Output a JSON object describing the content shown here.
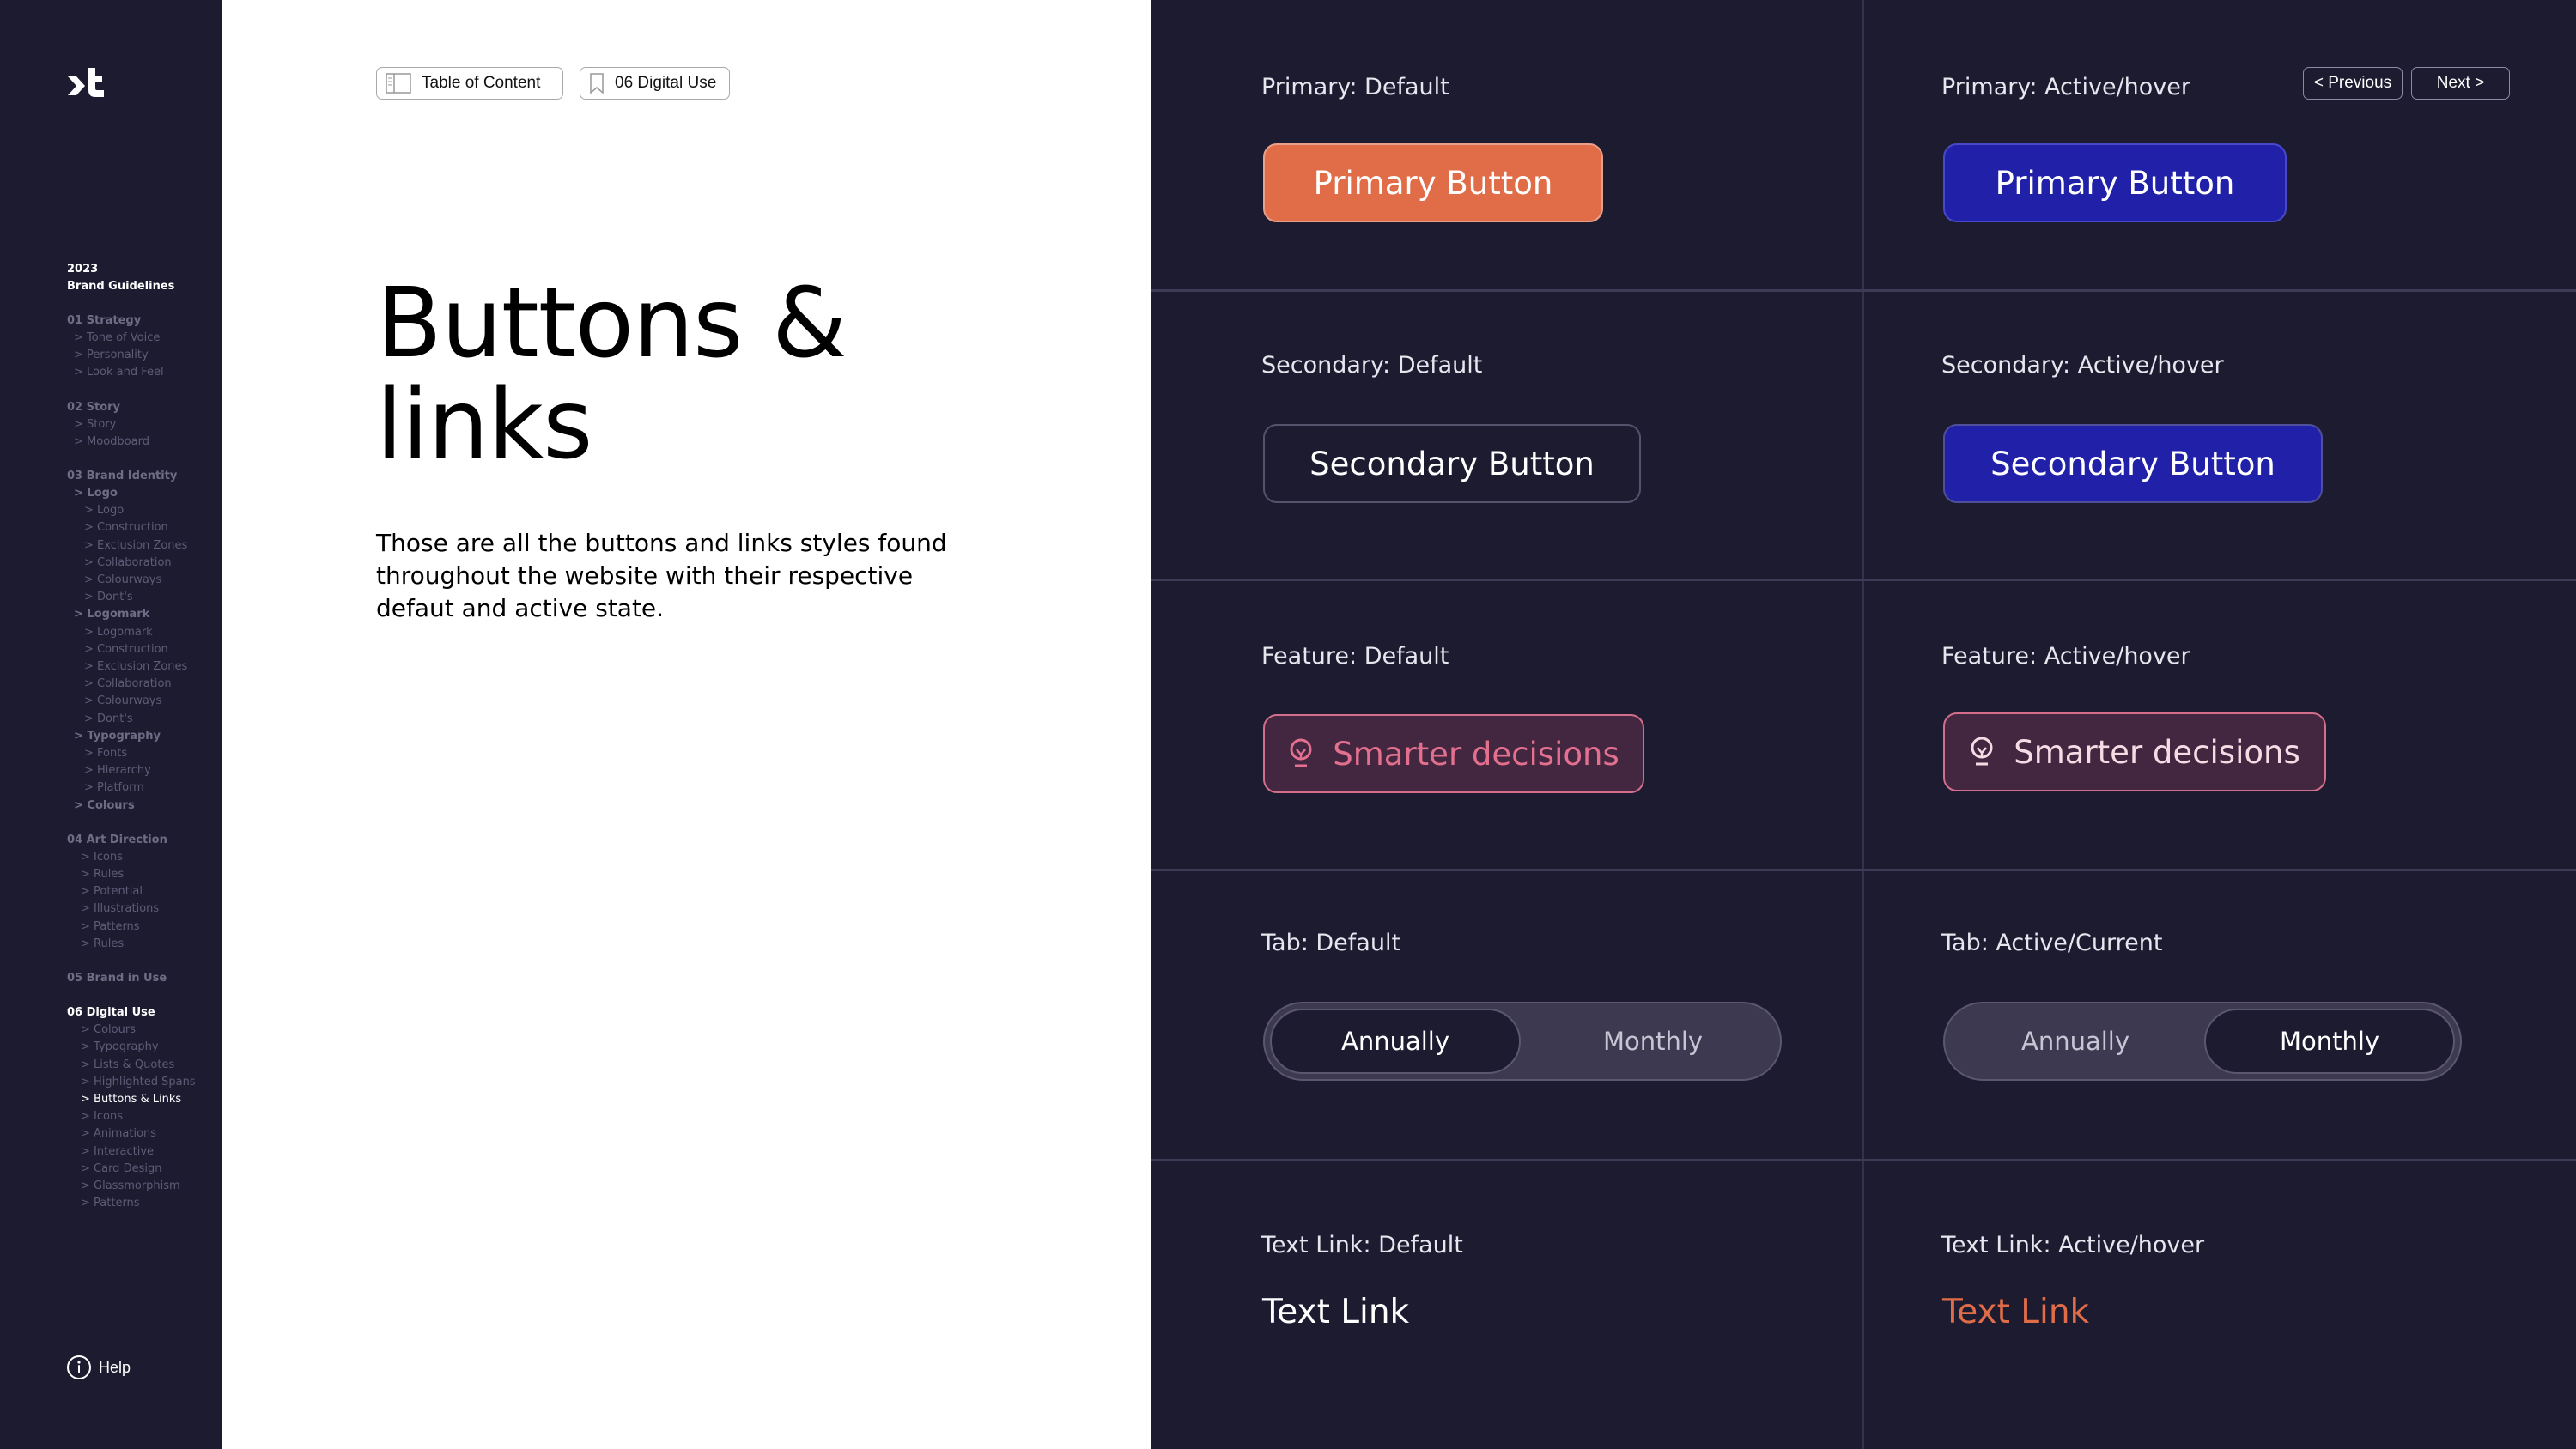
{
  "sidebar": {
    "logo": "xt",
    "year": "2023",
    "title": "Brand Guidelines",
    "groups": [
      {
        "head": "01 Strategy",
        "items": [
          "> Tone of Voice",
          "> Personality",
          "> Look and Feel"
        ]
      },
      {
        "head": "02 Story",
        "items": [
          "> Story",
          "> Moodboard"
        ]
      },
      {
        "head": "03 Brand Identity",
        "sections": [
          {
            "label": "> Logo",
            "items": [
              "> Logo",
              "> Construction",
              "> Exclusion Zones",
              "> Collaboration",
              "> Colourways",
              "> Dont's"
            ]
          },
          {
            "label": "> Logomark",
            "items": [
              "> Logomark",
              "> Construction",
              "> Exclusion Zones",
              "> Collaboration",
              "> Colourways",
              "> Dont's"
            ]
          },
          {
            "label": "> Typography",
            "items": [
              "> Fonts",
              "> Hierarchy",
              "> Platform"
            ]
          },
          {
            "label": "> Colours",
            "items": []
          }
        ]
      },
      {
        "head": "04 Art Direction",
        "items": [
          "> Icons",
          "> Rules",
          "> Potential",
          "> Illustrations",
          "> Patterns",
          "> Rules"
        ]
      },
      {
        "head": "05 Brand in Use",
        "items": []
      },
      {
        "head": "06 Digital Use",
        "items": [
          "> Colours",
          "> Typography",
          "> Lists & Quotes",
          "> Highlighted Spans",
          "> Buttons & Links",
          "> Icons",
          "> Animations",
          "> Interactive",
          "> Card Design",
          "> Glassmorphism",
          "> Patterns"
        ],
        "current": "> Buttons & Links"
      }
    ],
    "help": "Help"
  },
  "breadcrumb": {
    "toc": "Table of Content",
    "section": "06 Digital Use"
  },
  "page": {
    "title_line1": "Buttons &",
    "title_line2": "links",
    "description": "Those are all the buttons and links styles found throughout the website with their respective defaut and active state."
  },
  "pager": {
    "previous": "< Previous",
    "next": "Next >"
  },
  "showcase": {
    "primary": {
      "default_label": "Primary: Default",
      "active_label": "Primary: Active/hover",
      "button": "Primary Button"
    },
    "secondary": {
      "default_label": "Secondary: Default",
      "active_label": "Secondary: Active/hover",
      "button": "Secondary Button"
    },
    "feature": {
      "default_label": "Feature: Default",
      "active_label": "Feature: Active/hover",
      "button": "Smarter decisions",
      "icon": "lightbulb-icon"
    },
    "tab": {
      "default_label": "Tab: Default",
      "active_label": "Tab: Active/Current",
      "options": [
        "Annually",
        "Monthly"
      ],
      "default_selected": "Annually",
      "active_selected": "Monthly"
    },
    "textlink": {
      "default_label": "Text Link: Default",
      "active_label": "Text Link: Active/hover",
      "link": "Text Link"
    }
  },
  "colors": {
    "sidebar_bg": "#1d1b30",
    "primary_orange": "#e06d48",
    "active_blue": "#2020a8",
    "feature_bg": "#43263f",
    "feature_pink": "#e3708e",
    "link_active": "#e06d48"
  }
}
